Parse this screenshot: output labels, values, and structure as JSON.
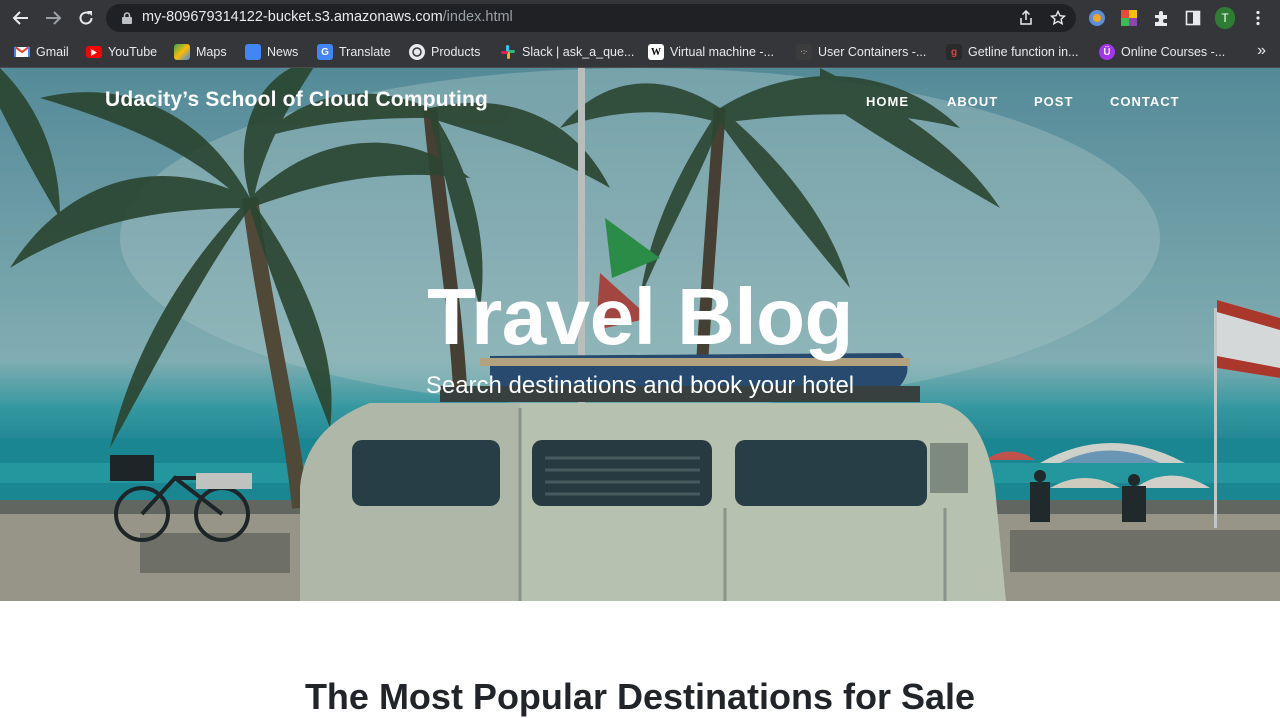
{
  "browser": {
    "url_main": "my-809679314122-bucket.s3.amazonaws.com",
    "url_path": "/index.html",
    "profile_initial": "T"
  },
  "bookmarks": [
    {
      "label": "Gmail",
      "icon": "gmail-icon",
      "color": "#ea4335"
    },
    {
      "label": "YouTube",
      "icon": "youtube-icon",
      "color": "#ff0000"
    },
    {
      "label": "Maps",
      "icon": "maps-icon",
      "color": "#34a853"
    },
    {
      "label": "News",
      "icon": "news-icon",
      "color": "#4285f4"
    },
    {
      "label": "Translate",
      "icon": "translate-icon",
      "color": "#4285f4"
    },
    {
      "label": "Products",
      "icon": "products-icon",
      "color": "#5f6368"
    },
    {
      "label": "Slack | ask_a_que...",
      "icon": "slack-icon",
      "color": "#e01e5a"
    },
    {
      "label": "Virtual machine -...",
      "icon": "wikipedia-icon",
      "color": "#ffffff"
    },
    {
      "label": "User Containers -...",
      "icon": "containers-icon",
      "color": "#444444"
    },
    {
      "label": "Getline function in...",
      "icon": "getline-icon",
      "color": "#333333"
    },
    {
      "label": "Online Courses -...",
      "icon": "udemy-icon",
      "color": "#a435f0"
    }
  ],
  "site": {
    "name": "Udacity’s School of Cloud Computing",
    "nav": [
      "HOME",
      "ABOUT",
      "POST",
      "CONTACT"
    ]
  },
  "hero": {
    "title": "Travel Blog",
    "subtitle": "Search destinations and book your hotel"
  },
  "section": {
    "heading": "The Most Popular Destinations for Sale"
  }
}
